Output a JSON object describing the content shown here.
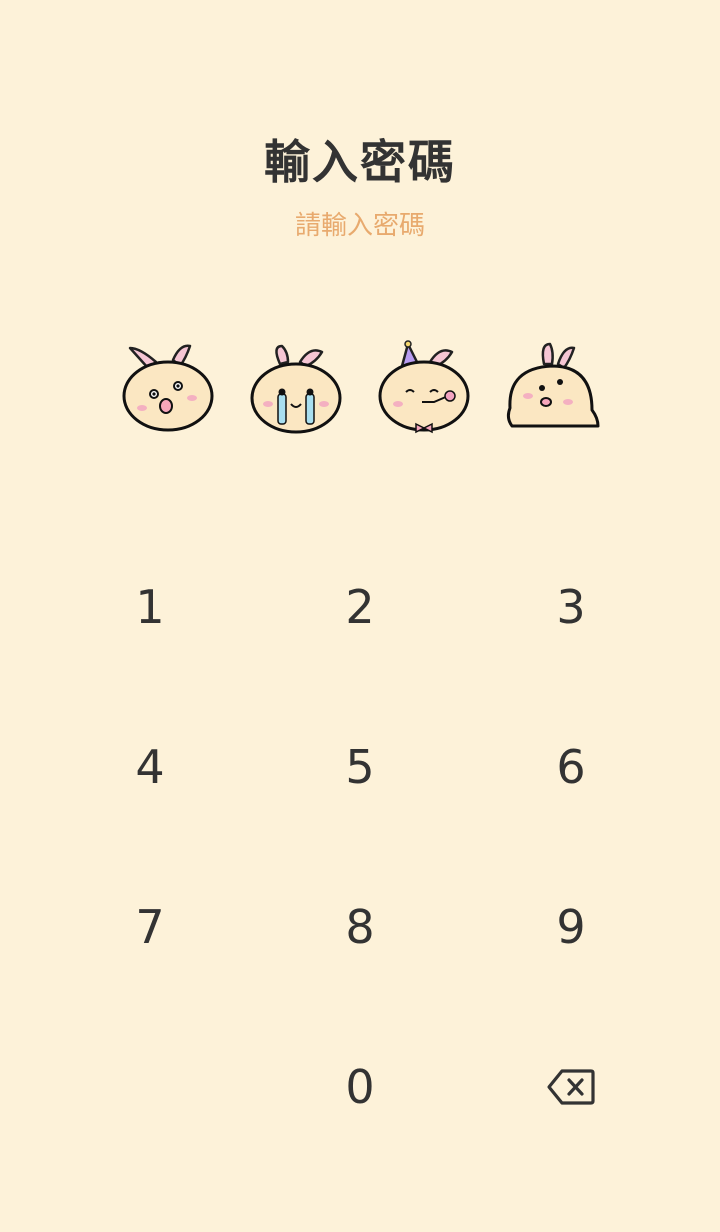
{
  "header": {
    "title": "輸入密碼",
    "subtitle": "請輸入密碼"
  },
  "indicators": [
    {
      "name": "bunny-tongue-icon"
    },
    {
      "name": "bunny-crying-icon"
    },
    {
      "name": "bunny-party-icon"
    },
    {
      "name": "bunny-melting-icon"
    }
  ],
  "keypad": {
    "keys": [
      "1",
      "2",
      "3",
      "4",
      "5",
      "6",
      "7",
      "8",
      "9",
      "0"
    ],
    "backspace_icon": "backspace-icon"
  },
  "colors": {
    "background": "#fdf2d9",
    "title": "#333333",
    "subtitle": "#e8aa6e",
    "bunny_fill": "#fbe7c2",
    "bunny_ear": "#f6c6d4",
    "blush": "#f3a3c0"
  }
}
